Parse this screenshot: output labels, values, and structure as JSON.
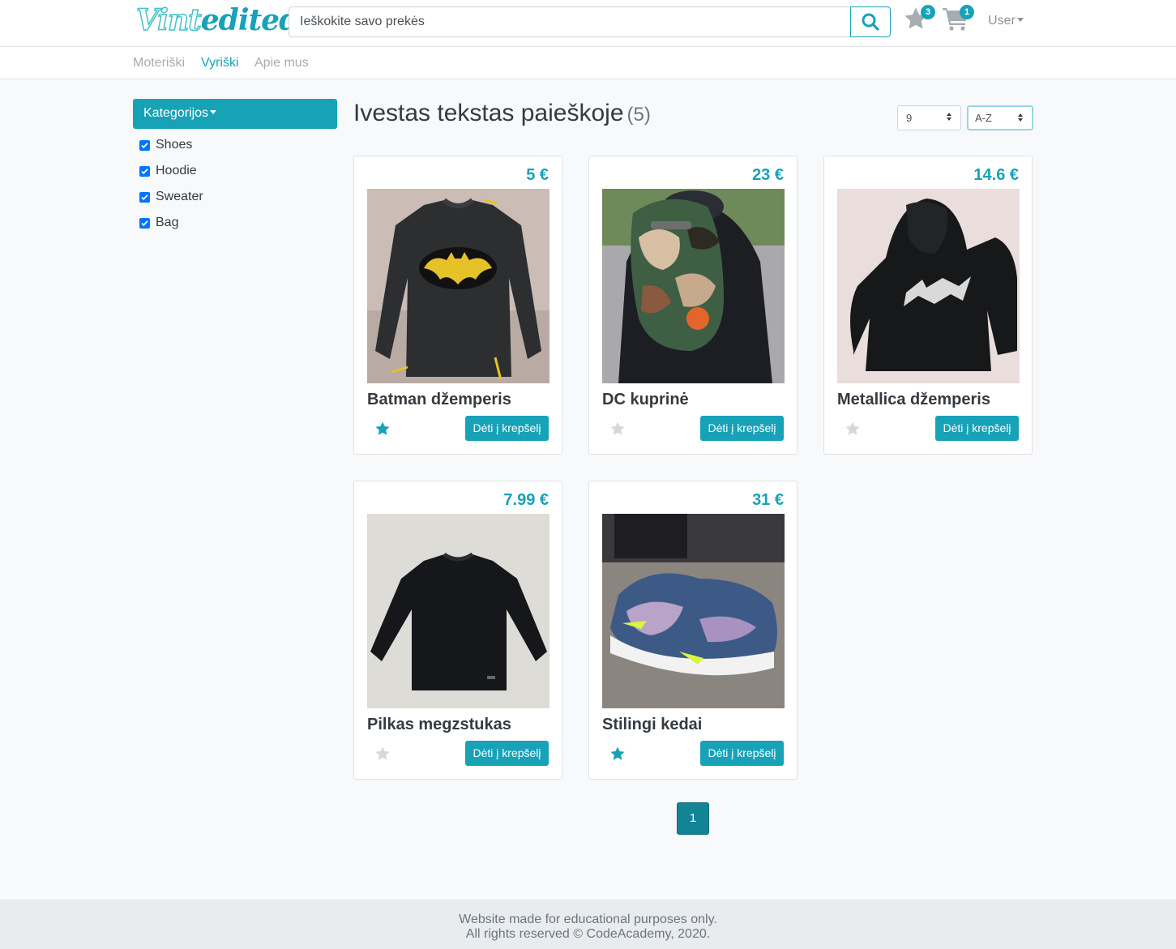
{
  "header": {
    "logo_part1": "Vint",
    "logo_part2": "edited",
    "search_placeholder": "Ieškokite savo prekės",
    "favorites_count": "3",
    "cart_count": "1",
    "user_label": "User"
  },
  "nav": {
    "items": [
      {
        "label": "Moteriški",
        "active": false
      },
      {
        "label": "Vyriški",
        "active": true
      },
      {
        "label": "Apie mus",
        "active": false
      }
    ]
  },
  "sidebar": {
    "title": "Kategorijos",
    "categories": [
      {
        "label": "Shoes",
        "checked": true
      },
      {
        "label": "Hoodie",
        "checked": true
      },
      {
        "label": "Sweater",
        "checked": true
      },
      {
        "label": "Bag",
        "checked": true
      }
    ]
  },
  "main": {
    "title": "Ivestas tekstas paieškoje",
    "count": "(5)",
    "per_page": "9",
    "sort": "A-Z",
    "add_to_cart_label": "Dėti į krepšelį",
    "products": [
      {
        "name": "Batman džemperis",
        "price": "5 €",
        "favorite": true,
        "image": "sweater-batman"
      },
      {
        "name": "DC kuprinė",
        "price": "23 €",
        "favorite": false,
        "image": "backpack-camo"
      },
      {
        "name": "Metallica džemperis",
        "price": "14.6 €",
        "favorite": false,
        "image": "hoodie-metallica"
      },
      {
        "name": "Pilkas megzstukas",
        "price": "7.99 €",
        "favorite": false,
        "image": "sweater-dark"
      },
      {
        "name": "Stilingi kedai",
        "price": "31 €",
        "favorite": true,
        "image": "sneakers"
      }
    ],
    "pagination": {
      "current": "1"
    }
  },
  "footer": {
    "line1": "Website made for educational purposes only.",
    "line2": "All rights reserved © CodeAcademy, 2020."
  },
  "colors": {
    "accent": "#17a2b8",
    "favorite_off": "#d6d9dc"
  }
}
